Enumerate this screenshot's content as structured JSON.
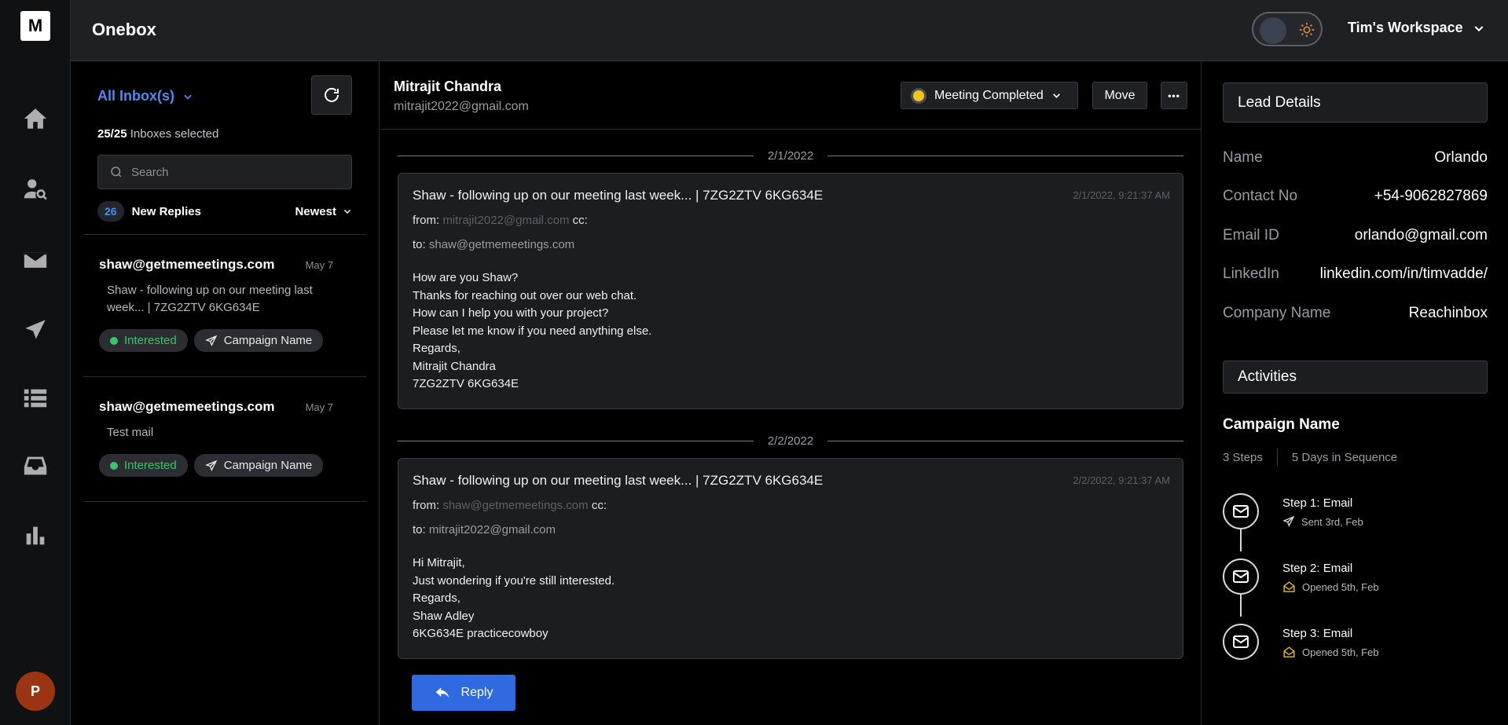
{
  "app": {
    "logo": "M",
    "title": "Onebox"
  },
  "workspace": {
    "label": "Tim's Workspace"
  },
  "user": {
    "avatar_initial": "P"
  },
  "inbox": {
    "selector_label": "All Inbox(s)",
    "selected_count": "25/25",
    "selected_label": "Inboxes selected",
    "search_placeholder": "Search",
    "new_replies_count": "26",
    "new_replies_label": "New Replies",
    "sort_label": "Newest",
    "threads": [
      {
        "from": "shaw@getmemeetings.com",
        "date": "May 7",
        "snippet": "Shaw - following up on our meeting last week... | 7ZG2ZTV 6KG634E",
        "status": "Interested",
        "campaign": "Campaign Name"
      },
      {
        "from": "shaw@getmemeetings.com",
        "date": "May 7",
        "snippet": "Test mail",
        "status": "Interested",
        "campaign": "Campaign Name"
      }
    ]
  },
  "conversation": {
    "contact_name": "Mitrajit Chandra",
    "contact_email": "mitrajit2022@gmail.com",
    "status_label": "Meeting Completed",
    "move_label": "Move",
    "more_label": "•••",
    "reply_label": "Reply",
    "messages": [
      {
        "date_divider": "2/1/2022",
        "subject": "Shaw - following up on our meeting last week... | 7ZG2ZTV 6KG634E",
        "timestamp": "2/1/2022, 9:21:37 AM",
        "from_label": "from:",
        "from": "mitrajit2022@gmail.com",
        "cc_label": "cc:",
        "to_label": "to:",
        "to": "shaw@getmemeetings.com",
        "body": [
          "How are you Shaw?",
          "Thanks for reaching out over our web chat.",
          "How can I help you with your project?",
          "Please let me know if you need anything else.",
          "Regards,",
          "Mitrajit Chandra",
          "7ZG2ZTV 6KG634E"
        ]
      },
      {
        "date_divider": "2/2/2022",
        "subject": "Shaw - following up on our meeting last week... | 7ZG2ZTV 6KG634E",
        "timestamp": "2/2/2022, 9:21:37 AM",
        "from_label": "from:",
        "from": "shaw@getmemeetings.com",
        "cc_label": "cc:",
        "to_label": "to:",
        "to": "mitrajit2022@gmail.com",
        "body": [
          "Hi Mitrajit,",
          "Just wondering if you're still interested.",
          "Regards,",
          "Shaw Adley",
          "6KG634E practicecowboy"
        ]
      }
    ]
  },
  "lead": {
    "header": "Lead Details",
    "fields": [
      {
        "key": "Name",
        "value": "Orlando"
      },
      {
        "key": "Contact No",
        "value": "+54-9062827869"
      },
      {
        "key": "Email ID",
        "value": "orlando@gmail.com"
      },
      {
        "key": "LinkedIn",
        "value": "linkedin.com/in/timvadde/"
      },
      {
        "key": "Company Name",
        "value": "Reachinbox"
      }
    ],
    "activities_header": "Activities",
    "campaign_name": "Campaign Name",
    "steps_count": "3 Steps",
    "sequence_days": "5 Days in Sequence",
    "steps": [
      {
        "title": "Step 1: Email",
        "status": "Sent 3rd, Feb",
        "icon": "send-icon"
      },
      {
        "title": "Step 2: Email",
        "status": "Opened 5th, Feb",
        "icon": "envelope-open-icon"
      },
      {
        "title": "Step 3: Email",
        "status": "Opened 5th, Feb",
        "icon": "envelope-open-icon"
      }
    ]
  },
  "colors": {
    "accent": "#4a8bf5",
    "interested": "#3ac569",
    "reply_button": "#2f6ae0",
    "opened": "#e8b923",
    "status_dot": "#f5c518"
  }
}
